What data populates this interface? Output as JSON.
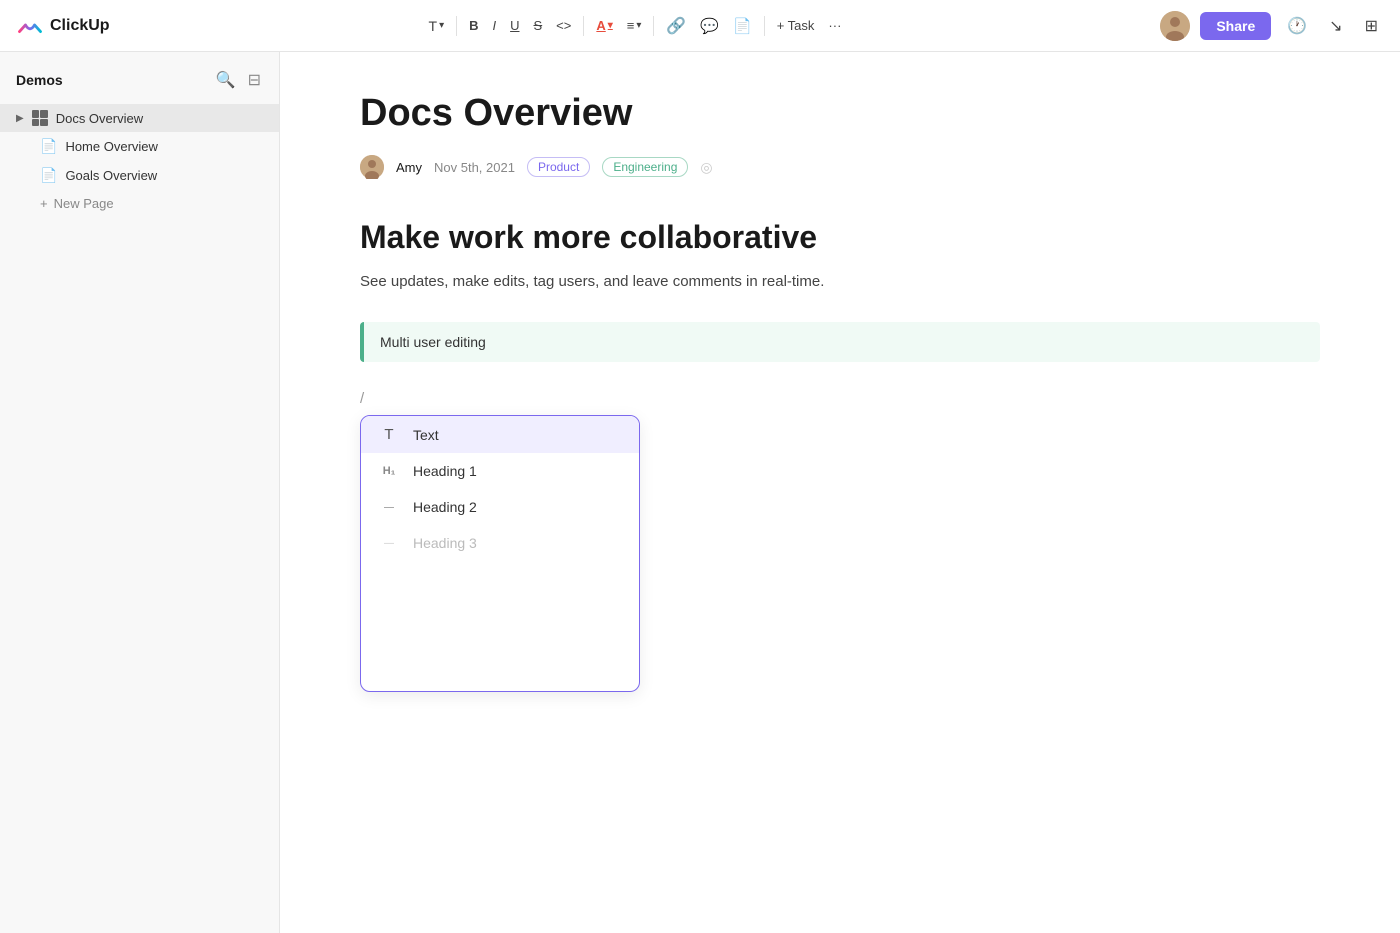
{
  "app": {
    "name": "ClickUp"
  },
  "toolbar": {
    "text_label": "T",
    "bold_label": "B",
    "italic_label": "I",
    "underline_label": "U",
    "strikethrough_label": "S",
    "code_label": "<>",
    "color_label": "A",
    "align_label": "≡",
    "link_label": "🔗",
    "comment_label": "💬",
    "doc_label": "📄",
    "task_label": "+ Task",
    "more_label": "···",
    "share_label": "Share"
  },
  "sidebar": {
    "title": "Demos",
    "items": [
      {
        "id": "docs-overview",
        "label": "Docs Overview",
        "type": "grid",
        "active": true
      },
      {
        "id": "home-overview",
        "label": "Home Overview",
        "type": "doc",
        "active": false
      },
      {
        "id": "goals-overview",
        "label": "Goals Overview",
        "type": "doc",
        "active": false
      }
    ],
    "new_page_label": "New Page"
  },
  "document": {
    "title": "Docs Overview",
    "author": "Amy",
    "date": "Nov 5th, 2021",
    "tags": [
      {
        "id": "product",
        "label": "Product",
        "type": "product"
      },
      {
        "id": "engineering",
        "label": "Engineering",
        "type": "engineering"
      }
    ],
    "heading": "Make work more collaborative",
    "subtitle": "See updates, make edits, tag users, and leave comments in real-time.",
    "blockquote": "Multi user editing",
    "slash": "/"
  },
  "dropdown": {
    "items": [
      {
        "id": "text",
        "label": "Text",
        "icon_type": "T",
        "selected": true
      },
      {
        "id": "heading1",
        "label": "Heading 1",
        "icon_type": "H1"
      },
      {
        "id": "heading2",
        "label": "Heading 2",
        "icon_type": "H2"
      },
      {
        "id": "heading3",
        "label": "Heading 3",
        "icon_type": "H3"
      }
    ]
  },
  "colors": {
    "accent": "#7b68ee",
    "green": "#4caf8a",
    "blockquote_bg": "#f0faf5"
  }
}
